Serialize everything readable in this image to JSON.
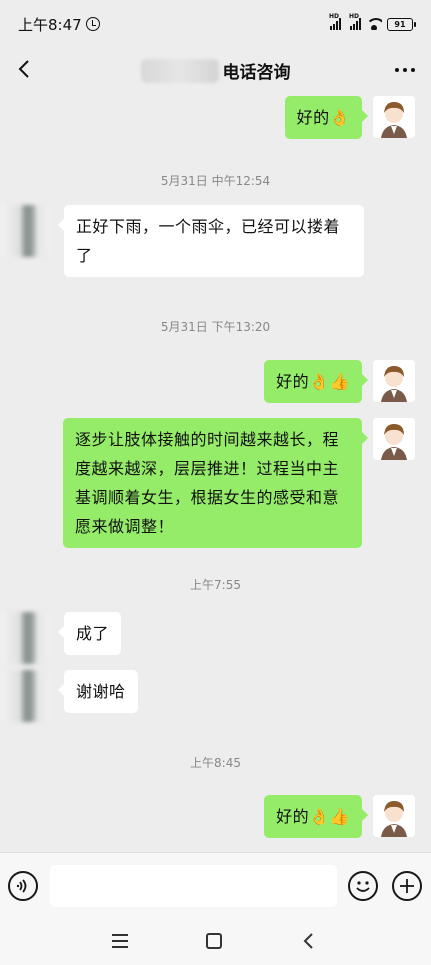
{
  "status": {
    "time": "上午8:47",
    "battery": "91",
    "hd1": "HD",
    "hd2": "HD"
  },
  "header": {
    "title": "电话咨询"
  },
  "messages": [
    {
      "from": "me",
      "text": "好的👌"
    },
    {
      "time": "5月31日 中午12:54"
    },
    {
      "from": "other",
      "text": "正好下雨，一个雨伞，已经可以搂着了"
    },
    {
      "time": "5月31日 下午13:20"
    },
    {
      "from": "me",
      "text": "好的👌👍"
    },
    {
      "from": "me",
      "text": "逐步让肢体接触的时间越来越长，程度越来越深，层层推进！过程当中主基调顺着女生，根据女生的感受和意愿来做调整！"
    },
    {
      "time": "上午7:55"
    },
    {
      "from": "other",
      "text": "成了"
    },
    {
      "from": "other",
      "text": "谢谢哈"
    },
    {
      "time": "上午8:45"
    },
    {
      "from": "me",
      "text": "好的👌👍"
    }
  ],
  "icons": {
    "back": "chevron-left-icon",
    "more": "more-dots-icon",
    "voice": "voice-icon",
    "emoji": "smile-icon",
    "plus": "plus-icon",
    "alarm": "alarm-clock-icon",
    "wifi": "wifi-icon"
  },
  "colors": {
    "my_bubble": "#95ec69",
    "other_bubble": "#ffffff",
    "background": "#ededed"
  }
}
